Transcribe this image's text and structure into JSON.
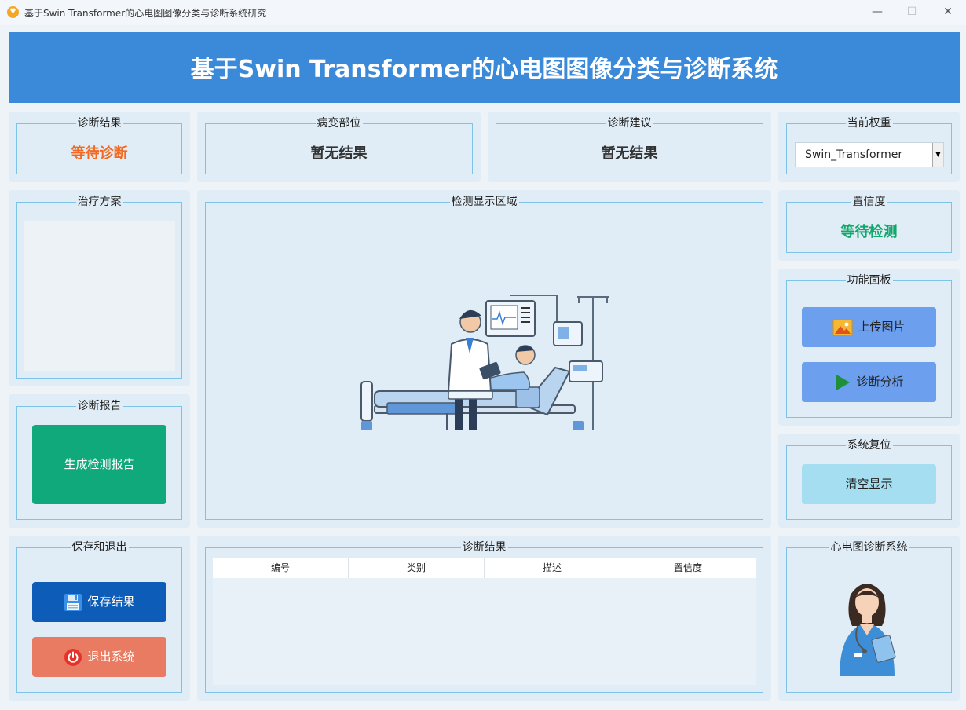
{
  "window": {
    "title": "基于Swin Transformer的心电图图像分类与诊断系统研究",
    "minimize": "—",
    "maximize": "☐",
    "close": "✕"
  },
  "header": {
    "title": "基于Swin Transformer的心电图图像分类与诊断系统"
  },
  "result": {
    "label": "诊断结果",
    "value": "等待诊断",
    "color": "#f26a22"
  },
  "lesion": {
    "label": "病变部位",
    "value": "暂无结果"
  },
  "advice": {
    "label": "诊断建议",
    "value": "暂无结果"
  },
  "weight": {
    "label": "当前权重",
    "selected": "Swin_Transformer"
  },
  "treatment": {
    "label": "治疗方案"
  },
  "display": {
    "label": "检测显示区域"
  },
  "confidence": {
    "label": "置信度",
    "value": "等待检测",
    "color": "#12a86b"
  },
  "functions": {
    "label": "功能面板",
    "upload_label": "上传图片",
    "diagnose_label": "诊断分析"
  },
  "report": {
    "label": "诊断报告",
    "generate_label": "生成检测报告"
  },
  "reset": {
    "label": "系统复位",
    "clear_label": "清空显示"
  },
  "save_exit": {
    "label": "保存和退出",
    "save_label": "保存结果",
    "exit_label": "退出系统"
  },
  "results_table": {
    "label": "诊断结果",
    "columns": [
      "编号",
      "类别",
      "描述",
      "置信度"
    ]
  },
  "system": {
    "label": "心电图诊断系统"
  }
}
